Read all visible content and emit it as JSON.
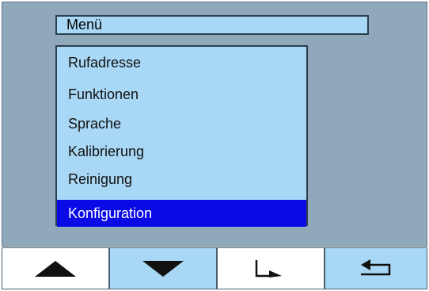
{
  "menu": {
    "title": "Menü",
    "items": [
      {
        "label": "Rufadresse",
        "selected": false
      },
      {
        "label": "Funktionen",
        "selected": false
      },
      {
        "label": "Sprache",
        "selected": false
      },
      {
        "label": "Kalibrierung",
        "selected": false
      },
      {
        "label": "Reinigung",
        "selected": false
      },
      {
        "label": "Konfiguration",
        "selected": true
      }
    ]
  },
  "softkeys": [
    {
      "icon": "arrow-up-icon"
    },
    {
      "icon": "arrow-down-icon"
    },
    {
      "icon": "enter-icon"
    },
    {
      "icon": "back-icon"
    }
  ],
  "colors": {
    "screen_background": "#8fa8ba",
    "panel_background": "#a9d8f6",
    "selection": "#0a0ae6",
    "selection_text": "#ffffff"
  }
}
